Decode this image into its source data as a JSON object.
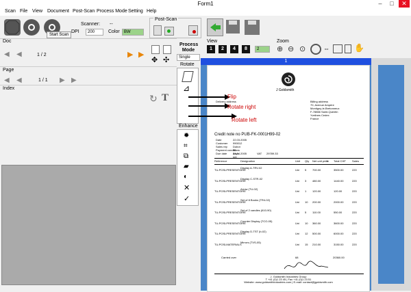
{
  "window": {
    "title": "Form1"
  },
  "menu": [
    "Scan",
    "File",
    "View",
    "Document",
    "Post-Scan",
    "Process Mode",
    "Setting",
    "Help"
  ],
  "scan": {
    "tooltip": "Start Scan",
    "scanner_label": "Scanner:",
    "scanner_value": "--",
    "dpi_label": "DPI",
    "dpi_value": "200",
    "color_label": "Color",
    "color_value": "BW"
  },
  "postscan": {
    "title": "Post-Scan"
  },
  "doc": {
    "label": "Doc",
    "counter": "1 / 2"
  },
  "page": {
    "label": "Page",
    "counter": "1 / 1"
  },
  "index": {
    "label": "Index"
  },
  "process_mode": {
    "label": "Process Mode",
    "value": "Single"
  },
  "rotate": {
    "label": "Rotate"
  },
  "enhance": {
    "label": "Enhance"
  },
  "view": {
    "label": "View",
    "buttons": [
      "1",
      "2",
      "4",
      "8"
    ],
    "select": "2"
  },
  "zoom": {
    "label": "Zoom"
  },
  "preview": {
    "tab": "1"
  },
  "annotations": {
    "flip": "Flip",
    "right": "Rotate right",
    "left": "Rotate left"
  },
  "invoice": {
    "company": "J Goldsmith",
    "delivery_header": "Delivery address",
    "billing_header": "Billing address",
    "billing_lines": [
      "70, Avenue Ampère",
      "Montigny-le-Bretonneux",
      "F-78866 Saint-Quentin",
      "Yvelines Cedex",
      "France"
    ],
    "credit_note": "Credit note no PUB-FK-0001H99-02",
    "meta": [
      [
        "Date",
        "22.03.2005"
      ],
      [
        "Customer",
        "990012"
      ],
      [
        "Sales rep",
        "Dubot"
      ],
      [
        "Payment conditions",
        "30 days net"
      ],
      [
        "Due date",
        "24.04.2005"
      ]
    ],
    "vat": [
      "VAT",
      "29789.33"
    ],
    "headers": [
      "Reference",
      "Designation",
      "Unit",
      "Qty",
      "Net unit price",
      "%",
      "Total CHF",
      "Sales"
    ],
    "rows": [
      [
        "TU-POSLPRESENTOIRE",
        "Display A-TRV-02",
        "Uni",
        "5",
        "700.00",
        "",
        "3500.00",
        "220"
      ],
      [
        "TU-POSLPRESENTOIRE",
        "Display C-STR-02",
        "Uni",
        "3",
        "480.00",
        "",
        "1440.00",
        "220"
      ],
      [
        "TU-POSLPRESENTOIRE",
        "Arrow (TU-02)",
        "Uni",
        "1",
        "120.00",
        "",
        "120.00",
        "220"
      ],
      [
        "TU-POSLPRESENTOIRE",
        "Set of 8 Books (TR4-02)",
        "Uni",
        "10",
        "200.00",
        "",
        "2000.00",
        "220"
      ],
      [
        "TU-POSLPRESENTOIRE",
        "Set of 2 candles (610-90)",
        "Uni",
        "5",
        "110.00",
        "",
        "550.00",
        "220"
      ],
      [
        "TU-POSLPRESENTOIRE",
        "Counter Display (TCO-05)",
        "Uni",
        "10",
        "360.00",
        "",
        "3600.00",
        "220"
      ],
      [
        "TU-POSLPRESENTOIRE",
        "Display D-TST (b-02)",
        "Uni",
        "12",
        "500.00",
        "",
        "6000.00",
        "220"
      ],
      [
        "TU-POSLMATERIALS",
        "Mirrors (TVS-05)",
        "Uni",
        "15",
        "210.00",
        "",
        "3150.00",
        "220"
      ]
    ],
    "carried_over": "Carried over",
    "carried_qty": "68",
    "carried_total": "20360.00",
    "footer": [
      "J. Goldsmith Industries Group",
      "T +41 (0)1 23 45 | Fax +41 (0)1 23 51",
      "Website: www.goldsmithindustries.com | E-mail: contact@jgoldsmith.com"
    ]
  }
}
